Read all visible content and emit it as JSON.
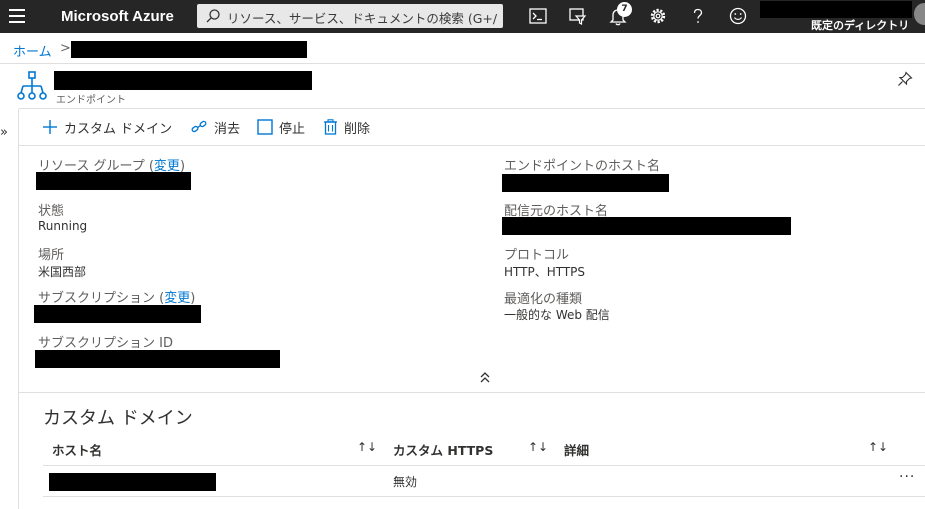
{
  "topbar": {
    "brand": "Microsoft Azure",
    "search_placeholder": "リソース、サービス、ドキュメントの検索 (G+/)",
    "notification_count": "7",
    "directory_label": "既定のディレクトリ"
  },
  "breadcrumb": {
    "home": "ホーム",
    "separator": ">"
  },
  "resource": {
    "type_label": "エンドポイント"
  },
  "commands": {
    "custom_domain": "カスタム ドメイン",
    "purge": "消去",
    "stop": "停止",
    "delete": "削除"
  },
  "essentials": {
    "resource_group_label": "リソース グループ",
    "change_link": "変更",
    "status_label": "状態",
    "status_value": "Running",
    "location_label": "場所",
    "location_value": "米国西部",
    "subscription_label": "サブスクリプション",
    "subscription_id_label": "サブスクリプション ID",
    "endpoint_host_label": "エンドポイントのホスト名",
    "origin_host_label": "配信元のホスト名",
    "protocol_label": "プロトコル",
    "protocol_value": "HTTP、HTTPS",
    "optimization_label": "最適化の種類",
    "optimization_value": "一般的な Web 配信"
  },
  "custom_domains": {
    "title": "カスタム ドメイン",
    "columns": [
      "ホスト名",
      "カスタム HTTPS",
      "詳細"
    ],
    "rows": [
      {
        "https": "無効"
      }
    ]
  },
  "icons": {
    "sort": "↑↓",
    "collapse": "chevron-double-up",
    "expand": "chevron-double-right"
  }
}
